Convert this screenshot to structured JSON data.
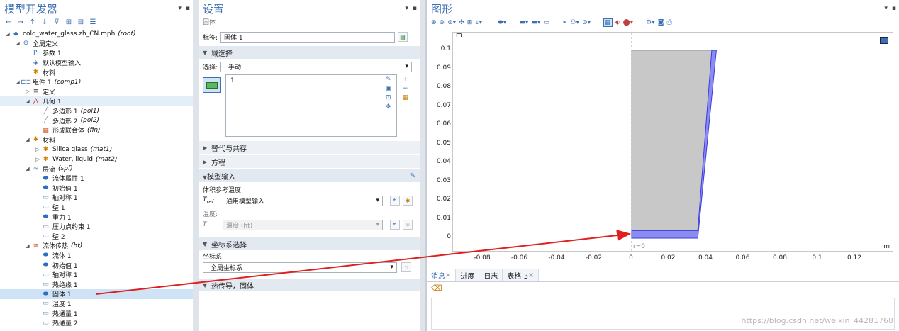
{
  "model_builder": {
    "title": "模型开发器",
    "tree": [
      {
        "indent": 0,
        "toggle": "open",
        "icon": "model",
        "label": "cold_water_glass.zh_CN.mph",
        "tag": "(root)"
      },
      {
        "indent": 1,
        "toggle": "open",
        "icon": "globe",
        "label": "全局定义",
        "tag": ""
      },
      {
        "indent": 2,
        "toggle": "",
        "icon": "param",
        "label": "参数 1",
        "tag": ""
      },
      {
        "indent": 2,
        "toggle": "",
        "icon": "input",
        "label": "默认模型输入",
        "tag": ""
      },
      {
        "indent": 2,
        "toggle": "",
        "icon": "material",
        "label": "材料",
        "tag": ""
      },
      {
        "indent": 1,
        "toggle": "open",
        "icon": "component",
        "label": "组件 1",
        "tag": "(comp1)"
      },
      {
        "indent": 2,
        "toggle": "closed",
        "icon": "def",
        "label": "定义",
        "tag": ""
      },
      {
        "indent": 2,
        "toggle": "open",
        "icon": "geometry",
        "label": "几何 1",
        "tag": "",
        "highlight": true
      },
      {
        "indent": 3,
        "toggle": "",
        "icon": "polygon",
        "label": "多边形 1",
        "tag": "(pol1)"
      },
      {
        "indent": 3,
        "toggle": "",
        "icon": "polygon",
        "label": "多边形 2",
        "tag": "(pol2)"
      },
      {
        "indent": 3,
        "toggle": "",
        "icon": "union",
        "label": "形成联合体",
        "tag": "(fin)"
      },
      {
        "indent": 2,
        "toggle": "open",
        "icon": "material",
        "label": "材料",
        "tag": ""
      },
      {
        "indent": 3,
        "toggle": "closed",
        "icon": "material",
        "label": "Silica glass",
        "tag": "(mat1)"
      },
      {
        "indent": 3,
        "toggle": "closed",
        "icon": "material",
        "label": "Water, liquid",
        "tag": "(mat2)"
      },
      {
        "indent": 2,
        "toggle": "open",
        "icon": "flow",
        "label": "层流",
        "tag": "(spf)"
      },
      {
        "indent": 3,
        "toggle": "",
        "icon": "blue-node",
        "label": "流体属性 1",
        "tag": ""
      },
      {
        "indent": 3,
        "toggle": "",
        "icon": "blue-node",
        "label": "初始值 1",
        "tag": ""
      },
      {
        "indent": 3,
        "toggle": "",
        "icon": "boundary",
        "label": "轴对称 1",
        "tag": ""
      },
      {
        "indent": 3,
        "toggle": "",
        "icon": "boundary",
        "label": "壁 1",
        "tag": ""
      },
      {
        "indent": 3,
        "toggle": "",
        "icon": "blue-node",
        "label": "重力 1",
        "tag": ""
      },
      {
        "indent": 3,
        "toggle": "",
        "icon": "boundary",
        "label": "压力点约束 1",
        "tag": ""
      },
      {
        "indent": 3,
        "toggle": "",
        "icon": "boundary",
        "label": "壁 2",
        "tag": ""
      },
      {
        "indent": 2,
        "toggle": "open",
        "icon": "heat",
        "label": "流体传热",
        "tag": "(ht)"
      },
      {
        "indent": 3,
        "toggle": "",
        "icon": "blue-node",
        "label": "流体 1",
        "tag": ""
      },
      {
        "indent": 3,
        "toggle": "",
        "icon": "blue-node",
        "label": "初始值 1",
        "tag": ""
      },
      {
        "indent": 3,
        "toggle": "",
        "icon": "boundary",
        "label": "轴对称 1",
        "tag": ""
      },
      {
        "indent": 3,
        "toggle": "",
        "icon": "boundary",
        "label": "热绝缘 1",
        "tag": ""
      },
      {
        "indent": 3,
        "toggle": "",
        "icon": "blue-node",
        "label": "固体 1",
        "tag": "",
        "selected": true
      },
      {
        "indent": 3,
        "toggle": "",
        "icon": "boundary",
        "label": "温度 1",
        "tag": ""
      },
      {
        "indent": 3,
        "toggle": "",
        "icon": "boundary",
        "label": "热通量 1",
        "tag": ""
      },
      {
        "indent": 3,
        "toggle": "",
        "icon": "boundary",
        "label": "热通量 2",
        "tag": ""
      }
    ]
  },
  "settings": {
    "title": "设置",
    "subtitle": "固体",
    "label_caption": "标签:",
    "label_value": "固体 1",
    "sections": {
      "domain_selection": "域选择",
      "override": "替代与共存",
      "equation": "方程",
      "model_input": "模型输入",
      "coord_system": "坐标系选择",
      "heat_conduction": "热传导，固体"
    },
    "selection_caption": "选择:",
    "selection_value": "手动",
    "selection_list": [
      "1"
    ],
    "model_input": {
      "caption": "体积参考温度:",
      "t_ref_symbol": "T",
      "t_ref_sub": "ref",
      "t_ref_value": "通用模型输入",
      "temp_caption": "温度:",
      "t_symbol": "T",
      "t_value": "温度 (ht)"
    },
    "coord": {
      "caption": "坐标系:",
      "value": "全局坐标系"
    }
  },
  "graphics": {
    "title": "图形",
    "axis_unit_y": "m",
    "axis_unit_x": "m",
    "axis_label_r0": "r=0",
    "y_ticks": [
      "0.1",
      "0.09",
      "0.08",
      "0.07",
      "0.06",
      "0.05",
      "0.04",
      "0.03",
      "0.02",
      "0.01",
      "0"
    ],
    "x_ticks": [
      "-0.08",
      "-0.06",
      "-0.04",
      "-0.02",
      "0",
      "0.02",
      "0.04",
      "0.06",
      "0.08",
      "0.1",
      "0.12"
    ]
  },
  "bottom_tabs": [
    {
      "label": "消息",
      "closable": true,
      "active": true
    },
    {
      "label": "进度",
      "closable": false,
      "active": false
    },
    {
      "label": "日志",
      "closable": false,
      "active": false
    },
    {
      "label": "表格 3",
      "closable": true,
      "active": false
    }
  ],
  "watermark": "https://blog.csdn.net/weixin_44281768",
  "colors": {
    "accent": "#3d6fb3",
    "selection": "#cfe3f6",
    "glass": "#c8c8c8",
    "water_edge": "#4a4ae0",
    "arrow": "#e02020"
  }
}
